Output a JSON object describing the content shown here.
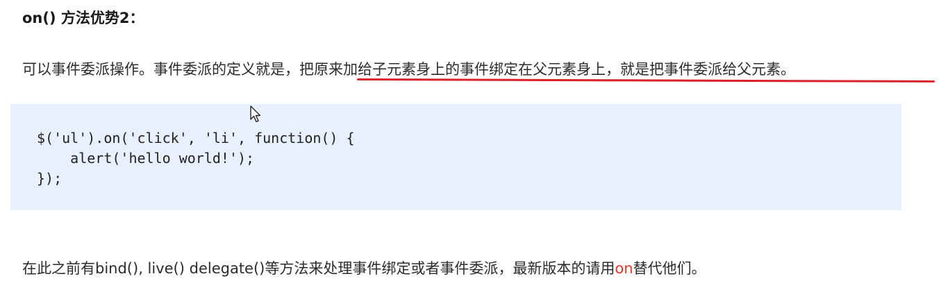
{
  "heading": "on() 方法优势2：",
  "paragraph1": {
    "text_plain": "可以事件委派操作。事件委派的定义就是，",
    "text_underlined": "把原来加给子元素身上的事件绑定在父元素身上，就是把事件委派给父元素。"
  },
  "code": {
    "lines": [
      "$('ul').on('click', 'li', function() {",
      "    alert('hello world!');",
      "});"
    ]
  },
  "paragraph2": {
    "before": "在此之前有bind(), live() delegate()等方法来处理事件绑定或者事件委派，最新版本的请用",
    "highlight": "on",
    "after": "替代他们。"
  },
  "colors": {
    "underline": "#d8232f",
    "highlight_text": "#e8362a",
    "code_background": "#e8f0fd"
  },
  "icons": {
    "cursor": "mouse-pointer-icon"
  }
}
